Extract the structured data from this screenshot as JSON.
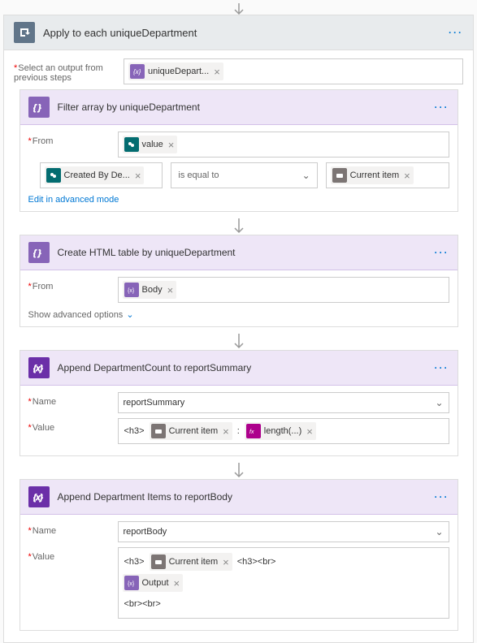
{
  "mainHeader": {
    "title": "Apply to each uniqueDepartment"
  },
  "selectOutput": {
    "label": "Select an output from previous steps",
    "token": "uniqueDepart..."
  },
  "filterArray": {
    "title": "Filter array by uniqueDepartment",
    "fromLabel": "From",
    "fromToken": "value",
    "left": "Created By De...",
    "op": "is equal to",
    "right": "Current item",
    "editLink": "Edit in advanced mode"
  },
  "createHtml": {
    "title": "Create HTML table by uniqueDepartment",
    "fromLabel": "From",
    "fromToken": "Body",
    "showAdv": "Show advanced options"
  },
  "appendCount": {
    "title": "Append DepartmentCount to reportSummary",
    "nameLabel": "Name",
    "nameValue": "reportSummary",
    "valueLabel": "Value",
    "prefix": "<h3>",
    "token1": "Current item",
    "sep": ":",
    "token2": "length(...)"
  },
  "appendItems": {
    "title": "Append Department Items to reportBody",
    "nameLabel": "Name",
    "nameValue": "reportBody",
    "valueLabel": "Value",
    "line1a": "<h3>",
    "line1token": "Current item",
    "line1b": "<h3><br>",
    "line2token": "Output",
    "line3": "<br><br>"
  }
}
